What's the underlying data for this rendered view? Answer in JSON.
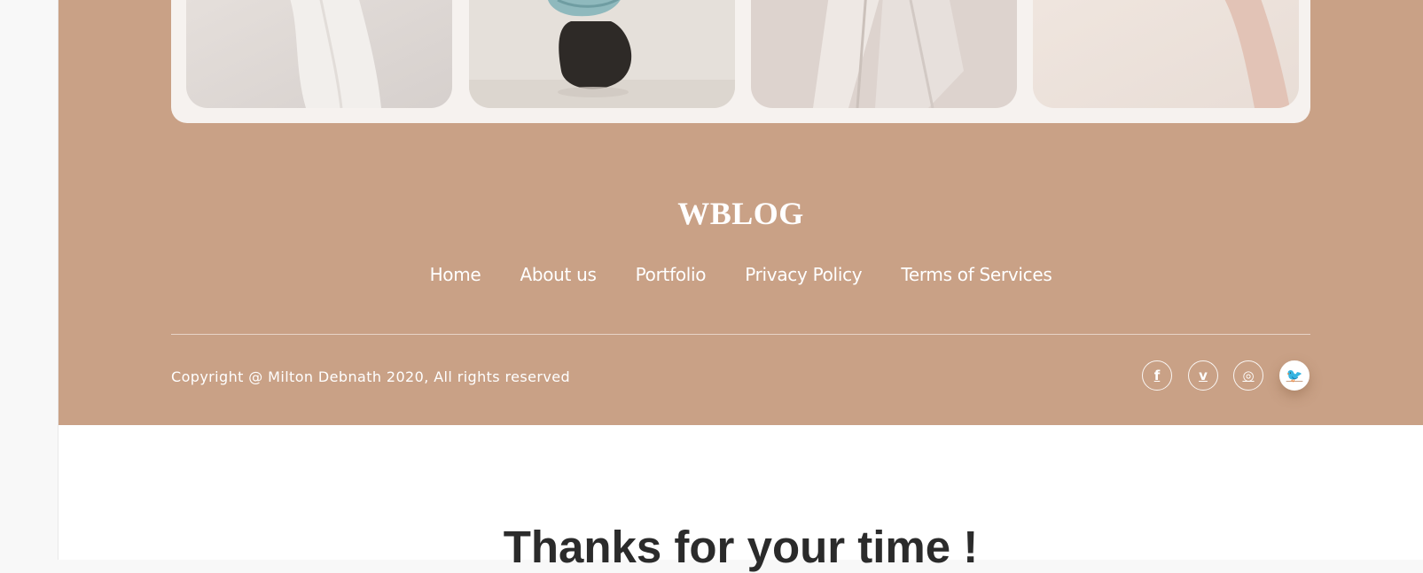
{
  "brand": {
    "logo": "WBLOG"
  },
  "nav": {
    "items": [
      {
        "label": "Home"
      },
      {
        "label": "About us"
      },
      {
        "label": "Portfolio"
      },
      {
        "label": "Privacy Policy"
      },
      {
        "label": "Terms of Services"
      }
    ]
  },
  "footer": {
    "copyright": "Copyright @ Milton Debnath 2020, All rights reserved",
    "social": [
      {
        "icon": "facebook-icon",
        "glyph": "f"
      },
      {
        "icon": "vimeo-icon",
        "glyph": "v"
      },
      {
        "icon": "instagram-icon",
        "glyph": "◎"
      },
      {
        "icon": "twitter-icon",
        "glyph": "🐦"
      }
    ]
  },
  "gallery": {
    "images": [
      {
        "subject": "white-fabric-photo"
      },
      {
        "subject": "sculpture-photo"
      },
      {
        "subject": "draped-cloth-photo"
      },
      {
        "subject": "hand-photo"
      }
    ]
  },
  "main": {
    "heading": "Thanks for your time !"
  },
  "colors": {
    "footer_bg": "#c9a186",
    "card_bg": "#f6f2ef",
    "heading_text": "#2b2b2b",
    "page_bg": "#ffffff"
  }
}
